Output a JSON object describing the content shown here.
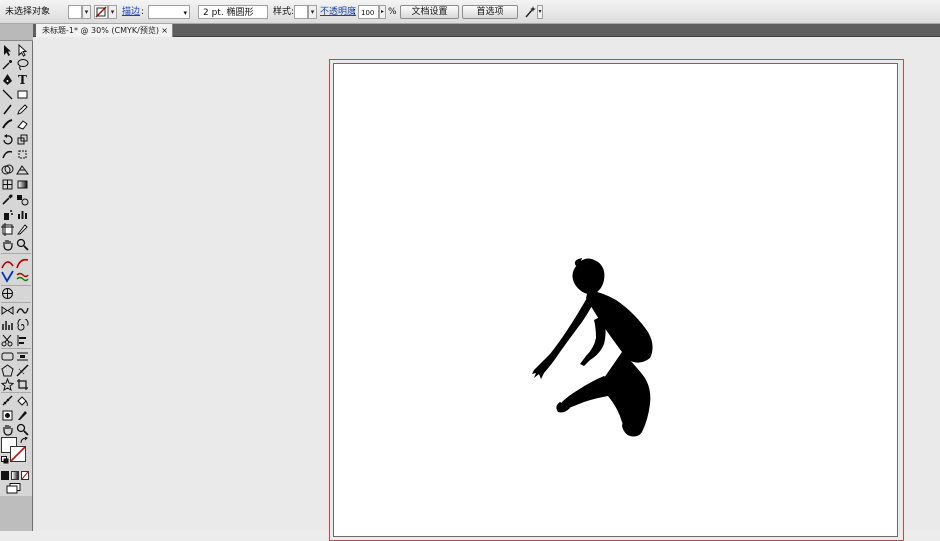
{
  "control_bar": {
    "selection_status": "未选择对象",
    "stroke_label": "描边",
    "stroke_colon": ":",
    "brush_value": "2 pt. 椭圆形",
    "style_label": "样式",
    "style_colon": ":",
    "opacity_label": "不透明度",
    "opacity_colon": ":",
    "opacity_value": "100",
    "opacity_unit": "%",
    "doc_setup_button": "文档设置",
    "preferences_button": "首选项"
  },
  "document_tab": {
    "title": "未标题-1* @ 30% (CMYK/预览)",
    "close": "×"
  },
  "colors": {
    "artboard_bleed": "#b05050",
    "silhouette": "#000000",
    "link": "#1a3fbf"
  }
}
